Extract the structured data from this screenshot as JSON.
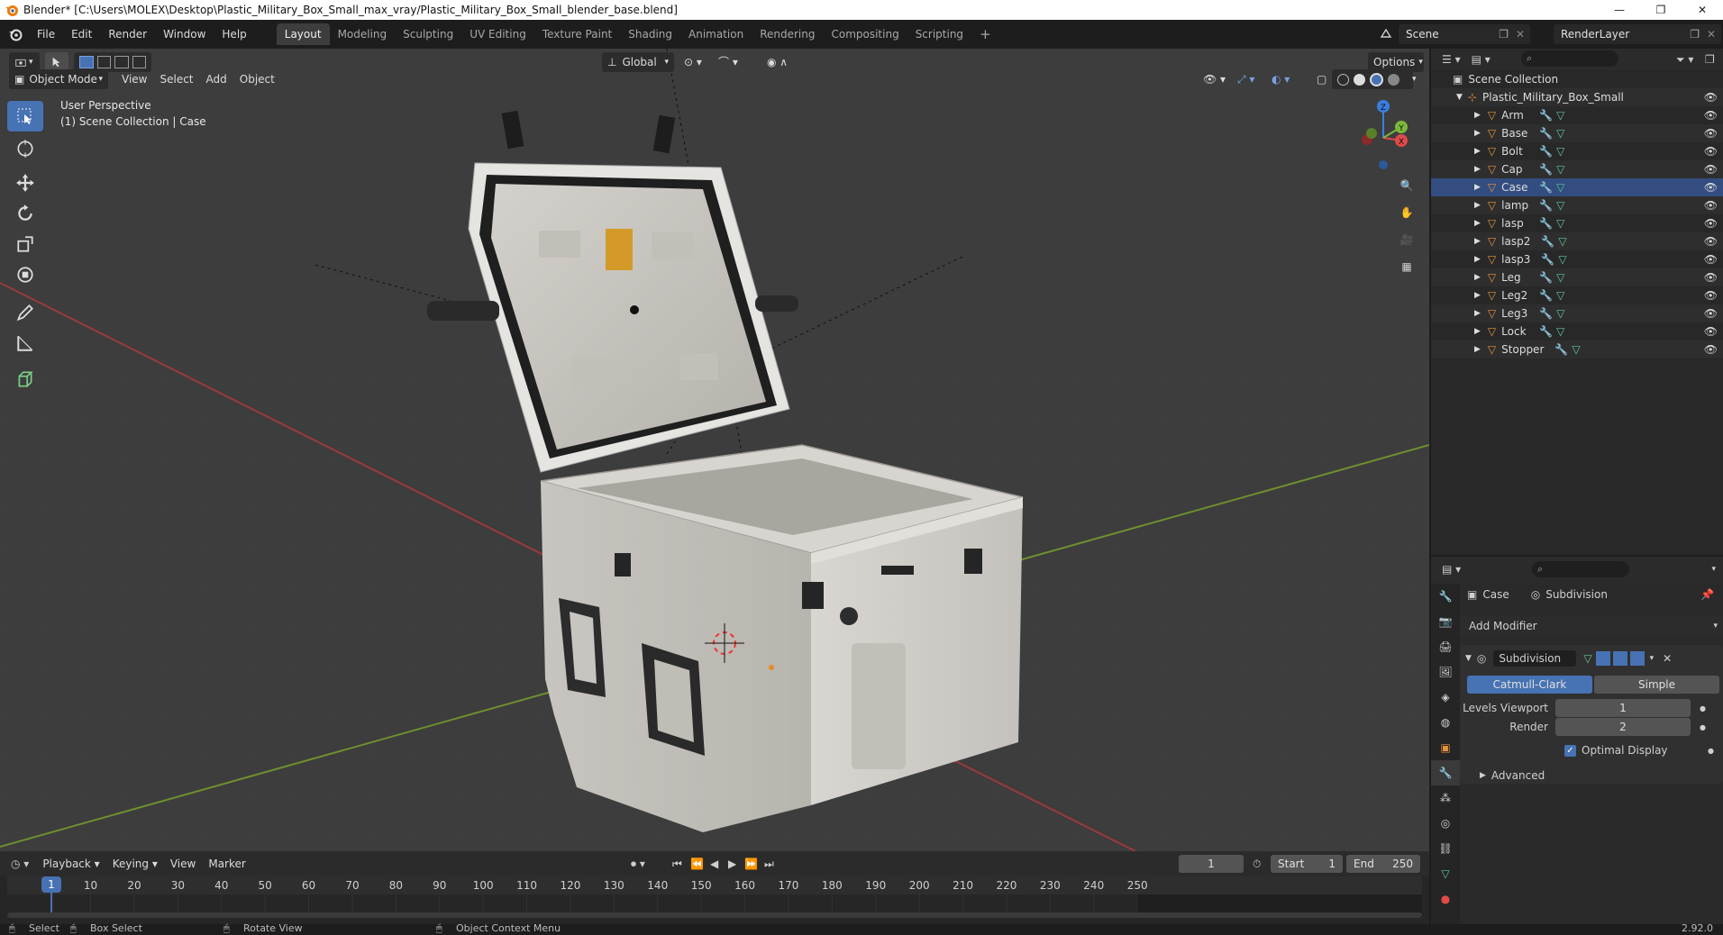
{
  "window": {
    "title": "Blender* [C:\\Users\\MOLEX\\Desktop\\Plastic_Military_Box_Small_max_vray/Plastic_Military_Box_Small_blender_base.blend]",
    "minimize": "—",
    "restore": "❐",
    "close": "✕"
  },
  "menu": {
    "file": "File",
    "edit": "Edit",
    "render": "Render",
    "window": "Window",
    "help": "Help"
  },
  "workspaces": [
    {
      "label": "Layout"
    },
    {
      "label": "Modeling"
    },
    {
      "label": "Sculpting"
    },
    {
      "label": "UV Editing"
    },
    {
      "label": "Texture Paint"
    },
    {
      "label": "Shading"
    },
    {
      "label": "Animation"
    },
    {
      "label": "Rendering"
    },
    {
      "label": "Compositing"
    },
    {
      "label": "Scripting"
    }
  ],
  "scene": {
    "name": "Scene",
    "render_layer": "RenderLayer"
  },
  "viewport_header": {
    "orientation": "Global",
    "options": "Options",
    "mode": "Object Mode",
    "view": "View",
    "select": "Select",
    "add": "Add",
    "object": "Object"
  },
  "viewport_info": {
    "perspective": "User Perspective",
    "collection": "(1) Scene Collection | Case"
  },
  "gizmo": {
    "x": "X",
    "y": "Y",
    "z": "Z"
  },
  "outliner": {
    "root": "Scene Collection",
    "parent": "Plastic_Military_Box_Small",
    "items": [
      {
        "label": "Arm"
      },
      {
        "label": "Base"
      },
      {
        "label": "Bolt"
      },
      {
        "label": "Cap"
      },
      {
        "label": "Case"
      },
      {
        "label": "lamp"
      },
      {
        "label": "lasp"
      },
      {
        "label": "lasp2"
      },
      {
        "label": "lasp3"
      },
      {
        "label": "Leg"
      },
      {
        "label": "Leg2"
      },
      {
        "label": "Leg3"
      },
      {
        "label": "Lock"
      },
      {
        "label": "Stopper"
      }
    ]
  },
  "properties": {
    "object": "Case",
    "modifier_context": "Subdivision",
    "add_modifier": "Add Modifier",
    "modifier_name": "Subdivision",
    "catmull": "Catmull-Clark",
    "simple": "Simple",
    "levels_label": "Levels Viewport",
    "levels_value": "1",
    "render_label": "Render",
    "render_value": "2",
    "optimal_display": "Optimal Display",
    "advanced": "Advanced"
  },
  "timeline": {
    "playback": "Playback",
    "keying": "Keying",
    "view": "View",
    "marker": "Marker",
    "current_frame": "1",
    "start_label": "Start",
    "start_value": "1",
    "end_label": "End",
    "end_value": "250",
    "ticks": [
      "1",
      "10",
      "20",
      "30",
      "40",
      "50",
      "60",
      "70",
      "80",
      "90",
      "100",
      "110",
      "120",
      "130",
      "140",
      "150",
      "160",
      "170",
      "180",
      "190",
      "200",
      "210",
      "220",
      "230",
      "240",
      "250"
    ]
  },
  "statusbar": {
    "select": "Select",
    "box_select": "Box Select",
    "rotate_view": "Rotate View",
    "context_menu": "Object Context Menu",
    "version": "2.92.0"
  },
  "colors": {
    "accent": "#4772b3",
    "object_orange": "#e8923a",
    "mesh_green": "#62c89a",
    "x_axis": "#e04a4a",
    "y_axis": "#7ab83a",
    "z_axis": "#3a7fe0"
  }
}
